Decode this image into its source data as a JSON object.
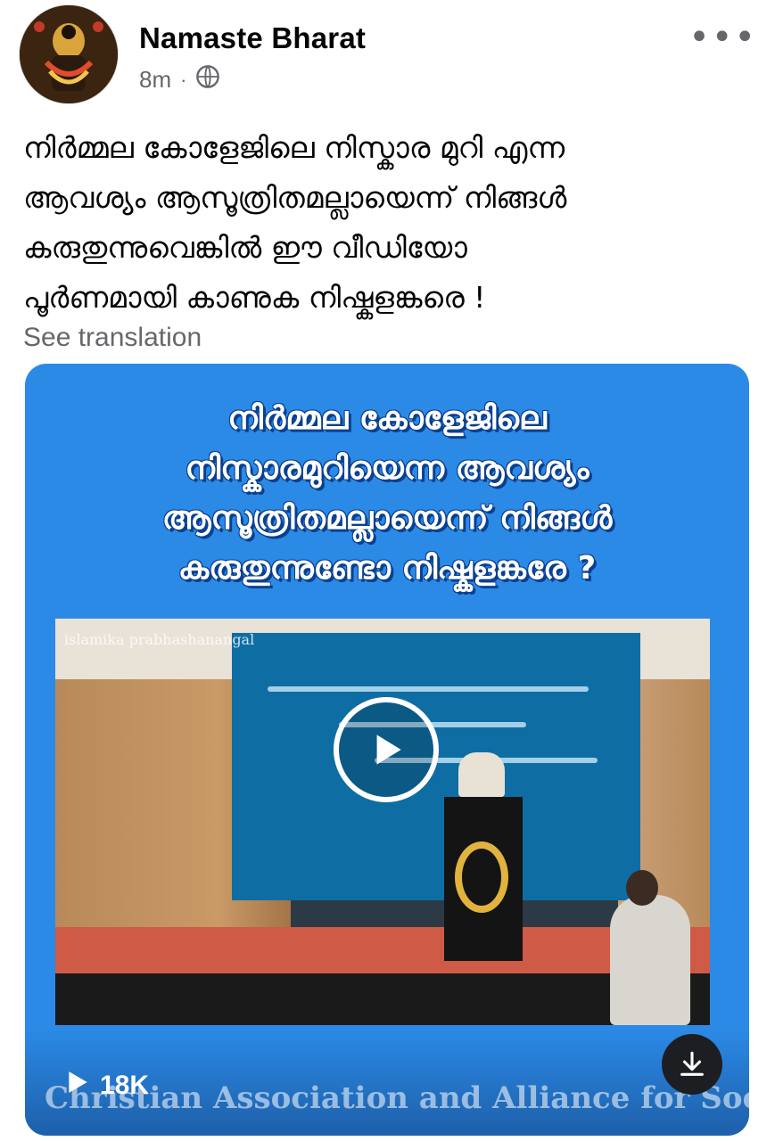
{
  "post": {
    "author": "Namaste Bharat",
    "time": "8m",
    "separator": "·",
    "text_lines": [
      "നിർമ്മല കോളേജിലെ നിസ്കാര മുറി എന്ന",
      "ആവശ്യം ആസൂത്രിതമല്ലായെന്ന് നിങ്ങൾ",
      "കരുതുന്നുവെങ്കിൽ ഈ വീഡിയോ",
      "പൂർണമായി കാണുക നിഷ്കളങ്കരെ !"
    ],
    "see_translation": "See translation"
  },
  "video": {
    "headline_lines": [
      "നിർമ്മല കോളേജിലെ",
      "നിസ്കാരമുറിയെന്ന ആവശ്യം",
      "ആസൂത്രിതമല്ലായെന്ന് നിങ്ങൾ",
      "കരുതുന്നുണ്ടോ നിഷ്കളങ്കരേ ?"
    ],
    "frame_watermark": "islamika prabhashanangal",
    "views": "18K",
    "overlay_text": "Christian Association and Alliance for Social Action"
  },
  "icons": {
    "avatar": "profile-avatar",
    "privacy": "globe-icon",
    "more": "more-options-icon",
    "play": "play-icon",
    "download": "download-icon"
  },
  "colors": {
    "accent": "#2b8ae6",
    "secondary_text": "#65676b"
  }
}
